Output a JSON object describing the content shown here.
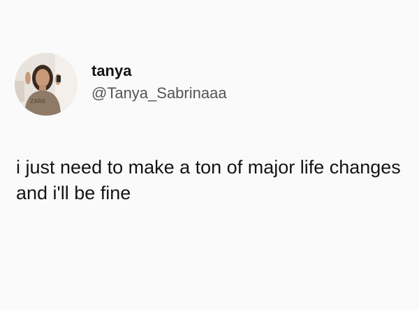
{
  "author": {
    "display_name": "tanya",
    "handle": "@Tanya_Sabrinaaa",
    "avatar_icon": "profile-photo"
  },
  "tweet": {
    "text": "i just need to make a ton of major life changes and i'll be fine"
  },
  "colors": {
    "background": "#fafafa",
    "text": "#141414",
    "handle": "#555555"
  }
}
